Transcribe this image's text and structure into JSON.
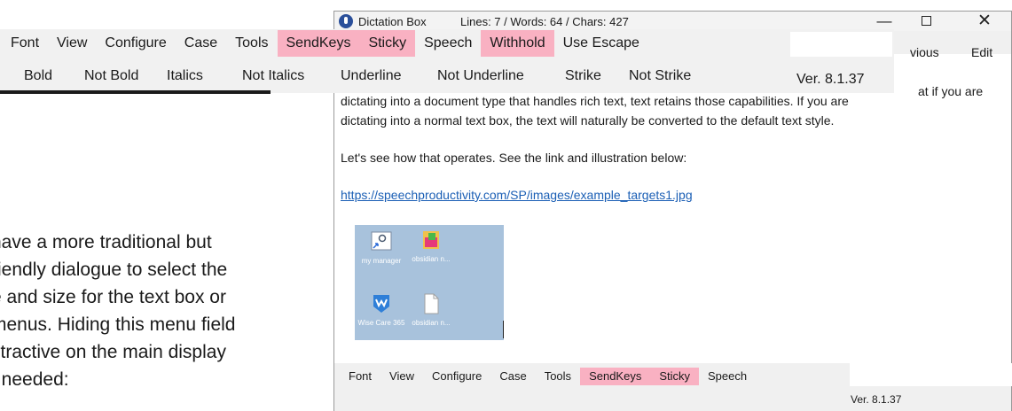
{
  "background_doc": {
    "lines": [
      "have a more traditional but",
      "riendly dialogue to select the",
      "e and size for the text box or",
      "menus. Hiding this menu field",
      "stractive on the main display",
      "t needed:"
    ]
  },
  "window": {
    "title": "Dictation Box",
    "stats": "Lines: 7 / Words: 64 / Chars: 427",
    "minimize_glyph": "—",
    "close_glyph": "✕",
    "nav": {
      "previous": "vious",
      "edit": "Edit"
    }
  },
  "overlay_toolbar": {
    "row1": [
      {
        "label": "Font",
        "highlighted": false
      },
      {
        "label": "View",
        "highlighted": false
      },
      {
        "label": "Configure",
        "highlighted": false
      },
      {
        "label": "Case",
        "highlighted": false
      },
      {
        "label": "Tools",
        "highlighted": false
      },
      {
        "label": "SendKeys",
        "highlighted": true
      },
      {
        "label": "Sticky",
        "highlighted": true
      },
      {
        "label": "Speech",
        "highlighted": false
      },
      {
        "label": "Withhold",
        "highlighted": true
      },
      {
        "label": "Use Escape",
        "highlighted": false
      }
    ],
    "row2": [
      "Bold",
      "Not Bold",
      "Italics",
      "Not Italics",
      "Underline",
      "Not Underline",
      "Strike",
      "Not Strike"
    ],
    "version": "Ver. 8.1.37",
    "highlight_color": "#f9b1c2"
  },
  "content": {
    "fragment": "at if you are",
    "p1_line2": "dictating into a document type that handles rich text, text retains those capabilities. If you are",
    "p1_line3": "dictating into a normal text box, the text will naturally be converted to the default text style.",
    "p2": "Let's see how that operates. See the link and illustration below:",
    "link": "https://speechproductivity.com/SP/images/example_targets1.jpg",
    "link_color": "#1b5fb5"
  },
  "desktop_image": {
    "icons": [
      {
        "label": "my manager",
        "icon": "settings-shortcut-icon"
      },
      {
        "label": "obsidian n...",
        "icon": "colorful-app-icon"
      },
      {
        "label": "Wise Care 365",
        "icon": "wise-care-icon"
      },
      {
        "label": "obsidian n...",
        "icon": "blank-document-icon"
      }
    ]
  },
  "bottom_toolbar": {
    "items": [
      {
        "label": "Font",
        "highlighted": false
      },
      {
        "label": "View",
        "highlighted": false
      },
      {
        "label": "Configure",
        "highlighted": false
      },
      {
        "label": "Case",
        "highlighted": false
      },
      {
        "label": "Tools",
        "highlighted": false
      },
      {
        "label": "SendKeys",
        "highlighted": true
      },
      {
        "label": "Sticky",
        "highlighted": true
      },
      {
        "label": "Speech",
        "highlighted": false
      }
    ],
    "version": "Ver. 8.1.37"
  }
}
